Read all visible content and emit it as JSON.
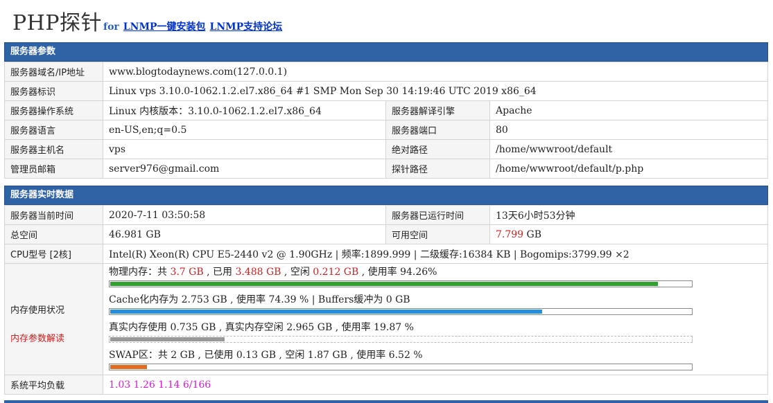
{
  "header": {
    "logo": "PHP探针",
    "for_text": "for",
    "link1": "LNMP一键安装包",
    "link2": "LNMP支持论坛"
  },
  "server_params": {
    "title": "服务器参数",
    "domain_label": "服务器域名/IP地址",
    "domain_value": "www.blogtodaynews.com(127.0.0.1)",
    "id_label": "服务器标识",
    "id_value": "Linux vps 3.10.0-1062.1.2.el7.x86_64 #1 SMP Mon Sep 30 14:19:46 UTC 2019 x86_64",
    "os_label": "服务器操作系统",
    "os_value": "Linux  内核版本：3.10.0-1062.1.2.el7.x86_64",
    "engine_label": "服务器解译引擎",
    "engine_value": "Apache",
    "lang_label": "服务器语言",
    "lang_value": "en-US,en;q=0.5",
    "port_label": "服务器端口",
    "port_value": "80",
    "host_label": "服务器主机名",
    "host_value": "vps",
    "abspath_label": "绝对路径",
    "abspath_value": "/home/wwwroot/default",
    "email_label": "管理员邮箱",
    "email_value": "server976@gmail.com",
    "probe_label": "探针路径",
    "probe_value": "/home/wwwroot/default/p.php"
  },
  "realtime": {
    "title": "服务器实时数据",
    "time_label": "服务器当前时间",
    "time_value": "2020-7-11 03:50:58",
    "uptime_label": "服务器已运行时间",
    "uptime_value": "13天6小时53分钟",
    "total_label": "总空间",
    "total_value": "46.981 GB",
    "free_label": "可用空间",
    "free_num": "7.799",
    "free_unit": " GB",
    "cpu_label": "CPU型号 [2核]",
    "cpu_value": "Intel(R) Xeon(R) CPU E5-2440 v2 @ 1.90GHz | 频率:1899.999 | 二级缓存:16384 KB | Bogomips:3799.99 ×2",
    "mem_label": "内存使用状况",
    "mem_link": "内存参数解读",
    "phys": {
      "p1": "物理内存：共 ",
      "total": "3.7 GB",
      "p2": " , 已用 ",
      "used": "3.488 GB",
      "p3": " , 空闲 ",
      "free": "0.212 GB",
      "p4": " , 使用率 94.26%",
      "percent": 94.26,
      "color": "#2ea12e"
    },
    "cache": {
      "text": "Cache化内存为 2.753 GB , 使用率 74.39 % | Buffers缓冲为 0 GB",
      "percent": 74.39,
      "color": "#2391e0"
    },
    "real": {
      "text": "真实内存使用 0.735 GB , 真实内存空闲 2.965 GB , 使用率 19.87 %",
      "percent": 19.87,
      "color": "#999999"
    },
    "swap": {
      "text": "SWAP区：共 2 GB , 已使用 0.13 GB , 空闲 1.87 GB , 使用率 6.52 %",
      "percent": 6.52,
      "color": "#e36b1c"
    },
    "load_label": "系统平均负载",
    "load_value": "1.03 1.26 1.14 6/166"
  }
}
